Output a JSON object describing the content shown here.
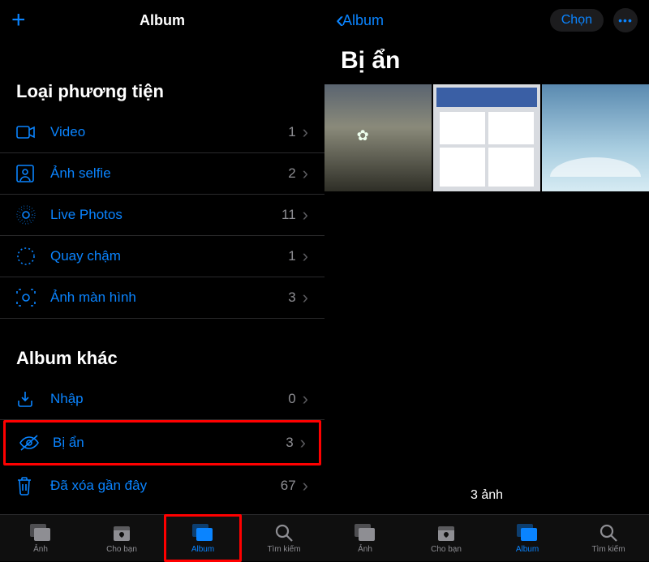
{
  "left": {
    "header_title": "Album",
    "section1": "Loại phương tiện",
    "rows1": [
      {
        "label": "Video",
        "count": "1",
        "icon": "video-icon"
      },
      {
        "label": "Ảnh selfie",
        "count": "2",
        "icon": "selfie-icon"
      },
      {
        "label": "Live Photos",
        "count": "11",
        "icon": "live-icon"
      },
      {
        "label": "Quay chậm",
        "count": "1",
        "icon": "slowmo-icon"
      },
      {
        "label": "Ảnh màn hình",
        "count": "3",
        "icon": "screenshot-icon"
      }
    ],
    "section2": "Album khác",
    "rows2": [
      {
        "label": "Nhập",
        "count": "0",
        "icon": "import-icon"
      },
      {
        "label": "Bị ẩn",
        "count": "3",
        "icon": "hidden-icon",
        "highlight": true
      },
      {
        "label": "Đã xóa gần đây",
        "count": "67",
        "icon": "trash-icon"
      }
    ],
    "tabs": [
      {
        "label": "Ảnh",
        "icon": "photos-tab-icon"
      },
      {
        "label": "Cho bạn",
        "icon": "foryou-tab-icon"
      },
      {
        "label": "Album",
        "icon": "album-tab-icon",
        "active": true,
        "highlight": true
      },
      {
        "label": "Tìm kiếm",
        "icon": "search-tab-icon"
      }
    ]
  },
  "right": {
    "back_label": "Album",
    "select_label": "Chọn",
    "page_title": "Bị ẩn",
    "count_text": "3 ảnh",
    "tabs": [
      {
        "label": "Ảnh",
        "icon": "photos-tab-icon"
      },
      {
        "label": "Cho bạn",
        "icon": "foryou-tab-icon"
      },
      {
        "label": "Album",
        "icon": "album-tab-icon",
        "active": true
      },
      {
        "label": "Tìm kiếm",
        "icon": "search-tab-icon"
      }
    ]
  }
}
